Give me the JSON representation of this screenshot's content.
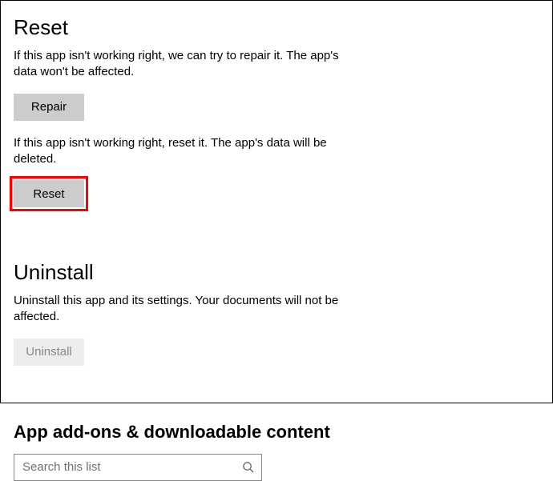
{
  "reset": {
    "heading": "Reset",
    "repair_desc": "If this app isn't working right, we can try to repair it. The app's data won't be affected.",
    "repair_label": "Repair",
    "reset_desc": "If this app isn't working right, reset it. The app's data will be deleted.",
    "reset_label": "Reset"
  },
  "uninstall": {
    "heading": "Uninstall",
    "desc": "Uninstall this app and its settings. Your documents will not be affected.",
    "button_label": "Uninstall"
  },
  "addons": {
    "heading": "App add-ons & downloadable content",
    "search_placeholder": "Search this list"
  }
}
